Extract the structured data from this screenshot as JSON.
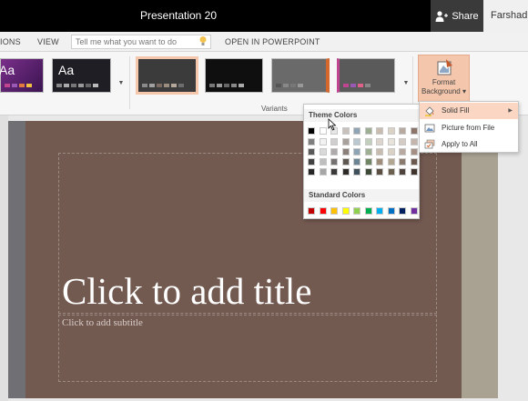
{
  "window": {
    "title": "Presentation 20",
    "share_label": "Share",
    "user_name": "Farshad I"
  },
  "tabs": {
    "items": [
      "IONS",
      "VIEW",
      "OPEN IN POWERPOINT"
    ],
    "tell_me_placeholder": "Tell me what you want to do"
  },
  "ribbon": {
    "theme_thumbs": [
      {
        "label": "Aa",
        "bg": "#5b2a6e"
      },
      {
        "label": "Aa",
        "bg": "#1e1e24"
      }
    ],
    "variant_thumbs": [
      {
        "bg": "#3b3b3b",
        "selected": true
      },
      {
        "bg": "#0f0f0f",
        "selected": false
      },
      {
        "bg": "#6a6a6a",
        "selected": false
      },
      {
        "bg": "#5a5a5a",
        "selected": false
      }
    ],
    "variants_label": "Variants",
    "format_background": {
      "line1": "Format",
      "line2": "Background ▾"
    }
  },
  "slide": {
    "title_placeholder": "Click to add title",
    "subtitle_placeholder": "Click to add subtitle",
    "background_color": "#735a51"
  },
  "color_picker": {
    "theme_colors_label": "Theme Colors",
    "standard_colors_label": "Standard Colors",
    "theme_base": [
      "#000000",
      "#ffffff",
      "#e7e6e6",
      "#44546a",
      "#4472c4",
      "#70ad47",
      "#8c8c8c",
      "#a5a5a5",
      "#9e8f85",
      "#ddd9d3"
    ],
    "theme_columns": [
      [
        "#000000",
        "#7f7f7f",
        "#595959",
        "#404040",
        "#262626"
      ],
      [
        "#ffffff",
        "#f2f2f2",
        "#d9d9d9",
        "#bfbfbf",
        "#a6a6a6"
      ],
      [
        "#e7e6e6",
        "#d0cece",
        "#aeaaaa",
        "#757171",
        "#3a3838"
      ],
      [
        "#c6c1bd",
        "#a8a09a",
        "#8b8079",
        "#5e5650",
        "#2e2a27"
      ],
      [
        "#8ea4b4",
        "#b9c7d1",
        "#8ea4b4",
        "#6a8494",
        "#3f4f59"
      ],
      [
        "#9eaf94",
        "#c3cfbd",
        "#9eaf94",
        "#6f8563",
        "#3d4a37"
      ],
      [
        "#c8bbb0",
        "#ddd4cd",
        "#c8bbb0",
        "#a08d7c",
        "#5b4e43"
      ],
      [
        "#d9d2c5",
        "#e8e3da",
        "#d9d2c5",
        "#b3a791",
        "#6b604d"
      ],
      [
        "#b7a99f",
        "#d4cbc4",
        "#b7a99f",
        "#8b7a6e",
        "#4f443d"
      ],
      [
        "#8b756a",
        "#c4b5ad",
        "#a48f84",
        "#6b594f",
        "#3f342e"
      ]
    ],
    "standard_colors": [
      "#c00000",
      "#ff0000",
      "#ffc000",
      "#ffff00",
      "#92d050",
      "#00b050",
      "#00b0f0",
      "#0070c0",
      "#002060",
      "#7030a0"
    ]
  },
  "format_menu": {
    "items": [
      {
        "label": "Solid Fill",
        "icon": "paint-bucket-icon",
        "active": true,
        "submenu": true
      },
      {
        "label": "Picture from File",
        "icon": "picture-icon",
        "active": false,
        "submenu": false
      },
      {
        "label": "Apply to All",
        "icon": "apply-all-icon",
        "active": false,
        "submenu": false
      }
    ]
  }
}
